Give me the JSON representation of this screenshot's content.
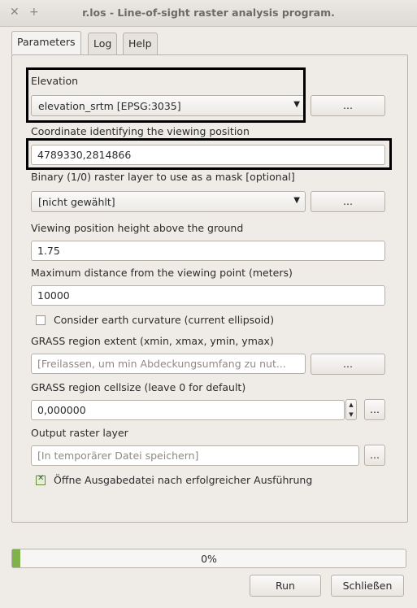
{
  "window": {
    "title": "r.los - Line-of-sight raster analysis program.",
    "close_glyph": "✕",
    "pin_glyph": "+"
  },
  "tabs": [
    {
      "label": "Parameters"
    },
    {
      "label": "Log"
    },
    {
      "label": "Help"
    }
  ],
  "params": {
    "elevation": {
      "label": "Elevation",
      "value": "elevation_srtm [EPSG:3035]"
    },
    "coordinate": {
      "label": "Coordinate identifying the viewing position",
      "value": "4789330,2814866"
    },
    "mask": {
      "label": "Binary (1/0) raster layer to use as a mask [optional]",
      "value": "[nicht gewählt]"
    },
    "obs_height": {
      "label": "Viewing position height above the ground",
      "value": "1.75"
    },
    "max_dist": {
      "label": "Maximum distance from the viewing point (meters)",
      "value": "10000"
    },
    "curvature": {
      "label": "Consider earth curvature (current ellipsoid)",
      "checked": false
    },
    "region_extent": {
      "label": "GRASS region extent (xmin, xmax, ymin, ymax)",
      "placeholder": "[Freilassen, um min Abdeckungsumfang zu nut..."
    },
    "cellsize": {
      "label": "GRASS region cellsize (leave 0 for default)",
      "value": "0,000000"
    },
    "output": {
      "label": "Output raster layer",
      "placeholder": "[In temporärer Datei speichern]"
    },
    "open_output": {
      "label": "Öffne Ausgabedatei nach erfolgreicher Ausführung",
      "checked": true
    }
  },
  "browse_label": "...",
  "spin_up": "▲",
  "spin_down": "▼",
  "dropdown_glyph": "▼",
  "progress": {
    "value": 0,
    "text": "0%"
  },
  "buttons": {
    "run": "Run",
    "close": "Schließen"
  }
}
